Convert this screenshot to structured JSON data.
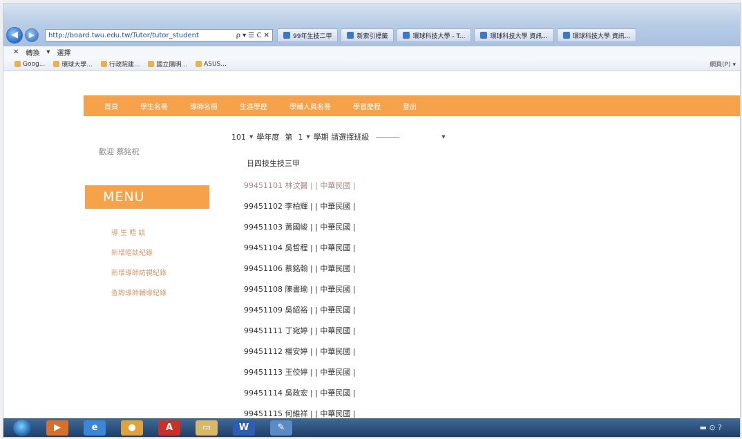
{
  "browser": {
    "address": "http://board.twu.edu.tw/Tutor/tutor_student",
    "address_controls": "ρ ▾ ☰ C ✕",
    "tabs": [
      "99年生技二甲",
      "新索引標籤",
      "環球科技大學 - T...",
      "環球科技大學 資訊...",
      "環球科技大學 資訊..."
    ],
    "command_bar": [
      "✕",
      "轉換",
      "▾",
      "選擇"
    ],
    "favorites": [
      "Goog...",
      "環球大學...",
      "行政院建...",
      "國立陽明...",
      "ASUS..."
    ],
    "tools": "網頁(P) ▾"
  },
  "nav": {
    "items": [
      "首頁",
      "學生名冊",
      "導師名冊",
      "生涯學歷",
      "學輔人員名冊",
      "學習歷程",
      "登出"
    ]
  },
  "sidebar": {
    "welcome": "歡迎 蔡銘祝",
    "menu_title": "MENU",
    "links": [
      "導 生 晤 談",
      "新增晤談紀錄",
      "新增導師訪視紀錄",
      "查詢導師輔導紀錄"
    ]
  },
  "selector": {
    "year": "101",
    "year_label": "學年度",
    "term_prefix": "第",
    "term": "1",
    "term_label": "學期 請選擇班級",
    "class_placeholder": ""
  },
  "class_title": "日四技生技三甲",
  "students": [
    "99451101 林汶醫 | | 中華民國 |",
    "99451102 李柏輝 | | 中華民國 |",
    "99451103 黃國峻 | | 中華民國 |",
    "99451104 吳哲程 | | 中華民國 |",
    "99451106 蔡銘翰 | | 中華民國 |",
    "99451108 陳書瑜 | | 中華民國 |",
    "99451109 吳紹裕 | | 中華民國 |",
    "99451111 丁宛婷 | | 中華民國 |",
    "99451112 楊安婷 | | 中華民國 |",
    "99451113 王佼婷 | | 中華民國 |",
    "99451114 吳政宏 | | 中華民國 |",
    "99451115 何維祥 | | 中華民國 |"
  ],
  "taskbar": {
    "icons": [
      "start",
      "media",
      "ie",
      "chrome",
      "pdf",
      "folder",
      "word",
      "paint"
    ],
    "tray": "▬ ⊙ ?"
  }
}
